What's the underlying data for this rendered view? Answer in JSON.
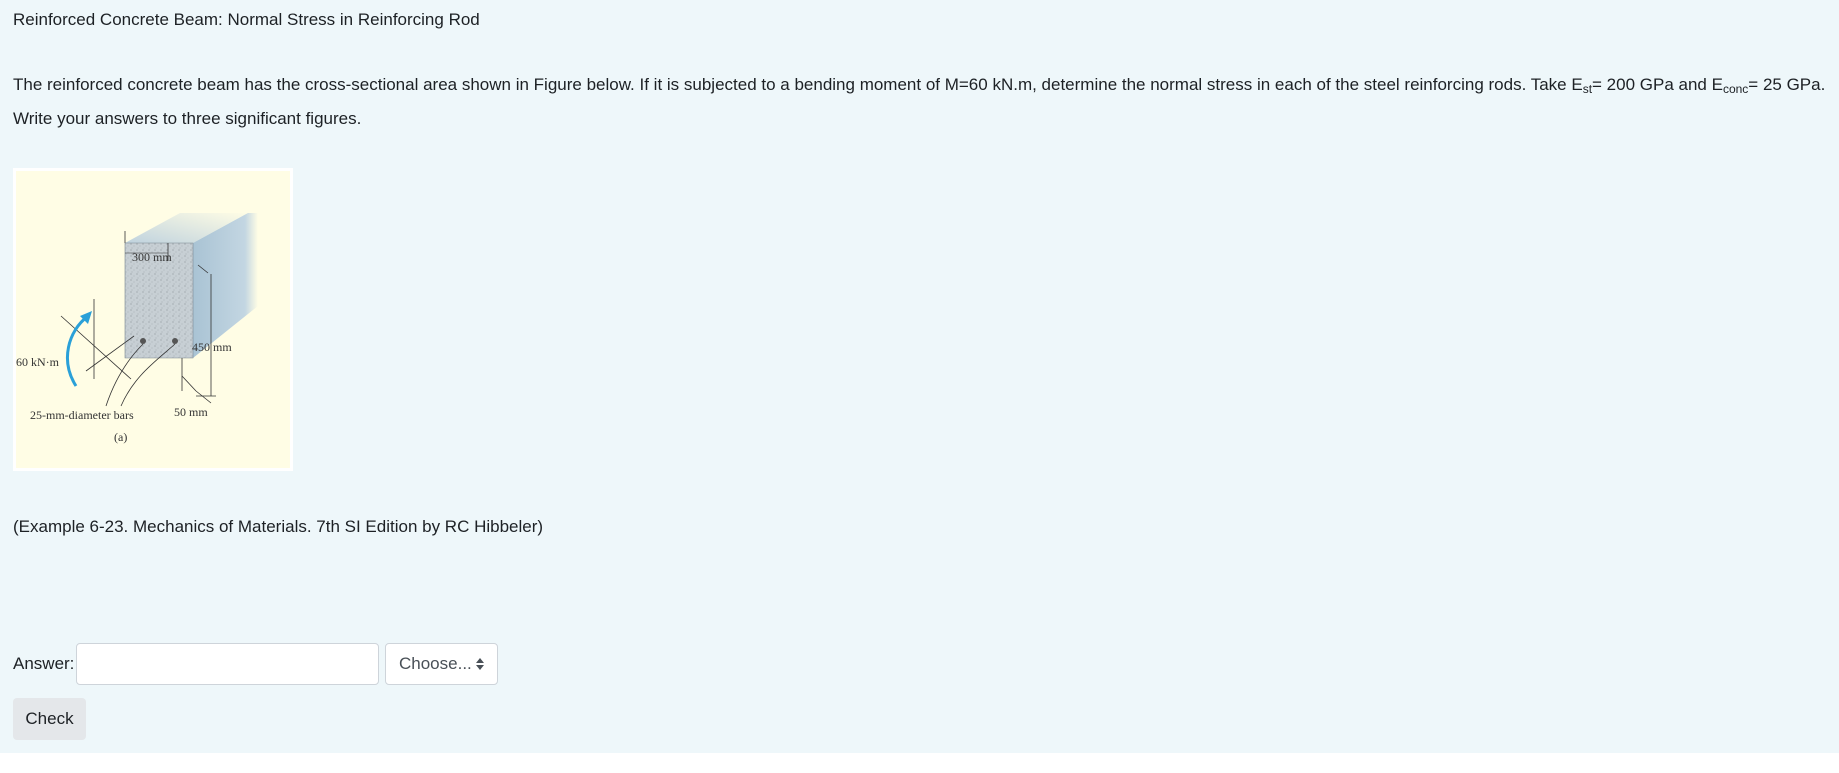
{
  "question": {
    "title": "Reinforced Concrete Beam: Normal Stress in Reinforcing Rod",
    "text_part1": "The reinforced concrete beam has the cross-sectional area shown in Figure below. If it is subjected to a bending moment of M=60 kN.m, determine the normal stress in each of the steel reinforcing rods. Take E",
    "est_sub": "st",
    "text_part2": "= 200 GPa and E",
    "econc_sub": "conc",
    "text_part3": "= 25 GPa.",
    "text_line2": "Write your answers to three significant figures.",
    "source": "(Example 6-23. Mechanics of Materials. 7th SI Edition by RC Hibbeler)"
  },
  "figure": {
    "label_width": "300 mm",
    "label_height": "450 mm",
    "label_moment": "60 kN·m",
    "label_bars": "25-mm-diameter bars",
    "label_cover": "50 mm",
    "label_caption": "(a)"
  },
  "answer": {
    "label": "Answer:",
    "value": "",
    "unit_select": "Choose..."
  },
  "actions": {
    "check_label": "Check"
  },
  "colors": {
    "panel_bg": "#eef7fa",
    "figure_bg": "#fffde5",
    "moment_arrow": "#2aa0d8"
  }
}
